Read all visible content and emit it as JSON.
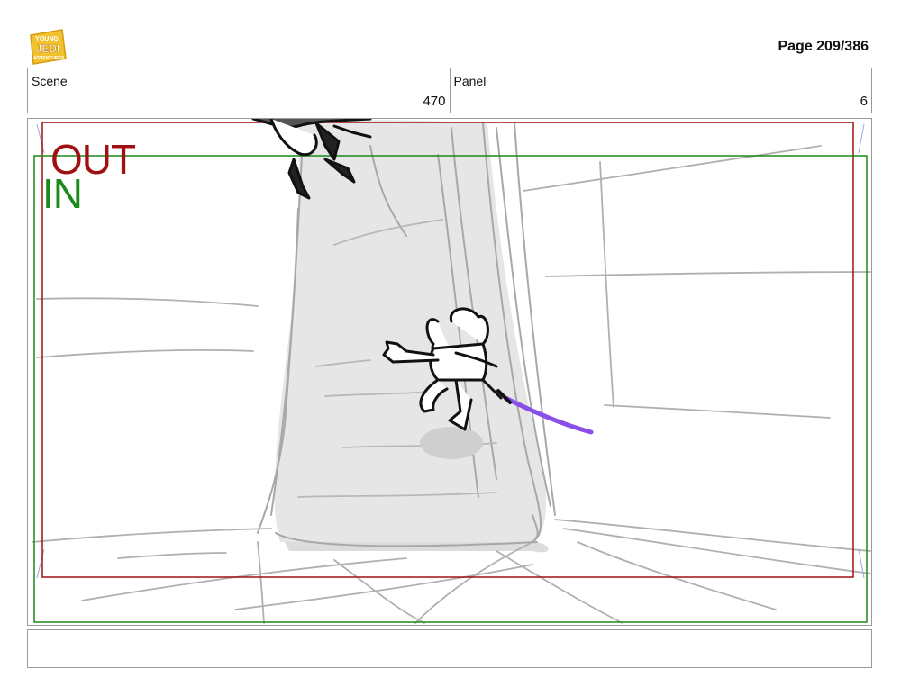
{
  "header": {
    "page_label": "Page 209/386",
    "logo_icon": "young-jedi-adventures-logo-icon"
  },
  "info": {
    "scene_label": "Scene",
    "scene_value": "470",
    "panel_label": "Panel",
    "panel_value": "6"
  },
  "frame": {
    "out_label": "OUT",
    "in_label": "IN",
    "out_color": "#a01010",
    "in_color": "#1a8a1a",
    "saber_color": "#8a4fe8"
  },
  "notes": {
    "text": ""
  }
}
